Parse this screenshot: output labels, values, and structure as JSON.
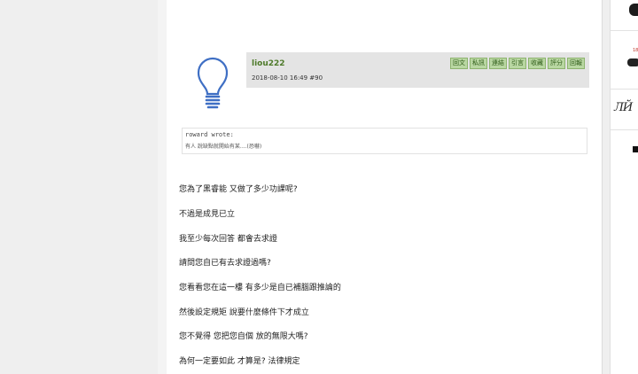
{
  "post": {
    "author": "liou222",
    "meta": "2018-08-10 16:49  #90",
    "actions": [
      "回文",
      "私訊",
      "連結",
      "引言",
      "收藏",
      "評分",
      "回報"
    ]
  },
  "quote": {
    "author_line": "roward wrote:",
    "text": "有人 說缺點就開始有某....(恐嚇)"
  },
  "content": {
    "lines": [
      "您為了黑睿能 又做了多少功課呢?",
      "不過是成見已立",
      "我至少每次回答 都會去求證",
      "請問您自已有去求證過嗎?",
      "您看看您在這一樓 有多少是自已補腦跟推論的",
      "然後設定規矩 說要什麼條件下才成立",
      "您不覺得 您把您自個 放的無限大嗎?",
      "為何一定要如此 才算是? 法律規定"
    ]
  },
  "icons": {
    "avatar": "lightbulb-icon"
  },
  "colors": {
    "author": "#4e7a2a",
    "button_bg": "#b9d7a2",
    "header_bg": "#e4e4e4",
    "avatar_stroke": "#3f6fc4"
  }
}
